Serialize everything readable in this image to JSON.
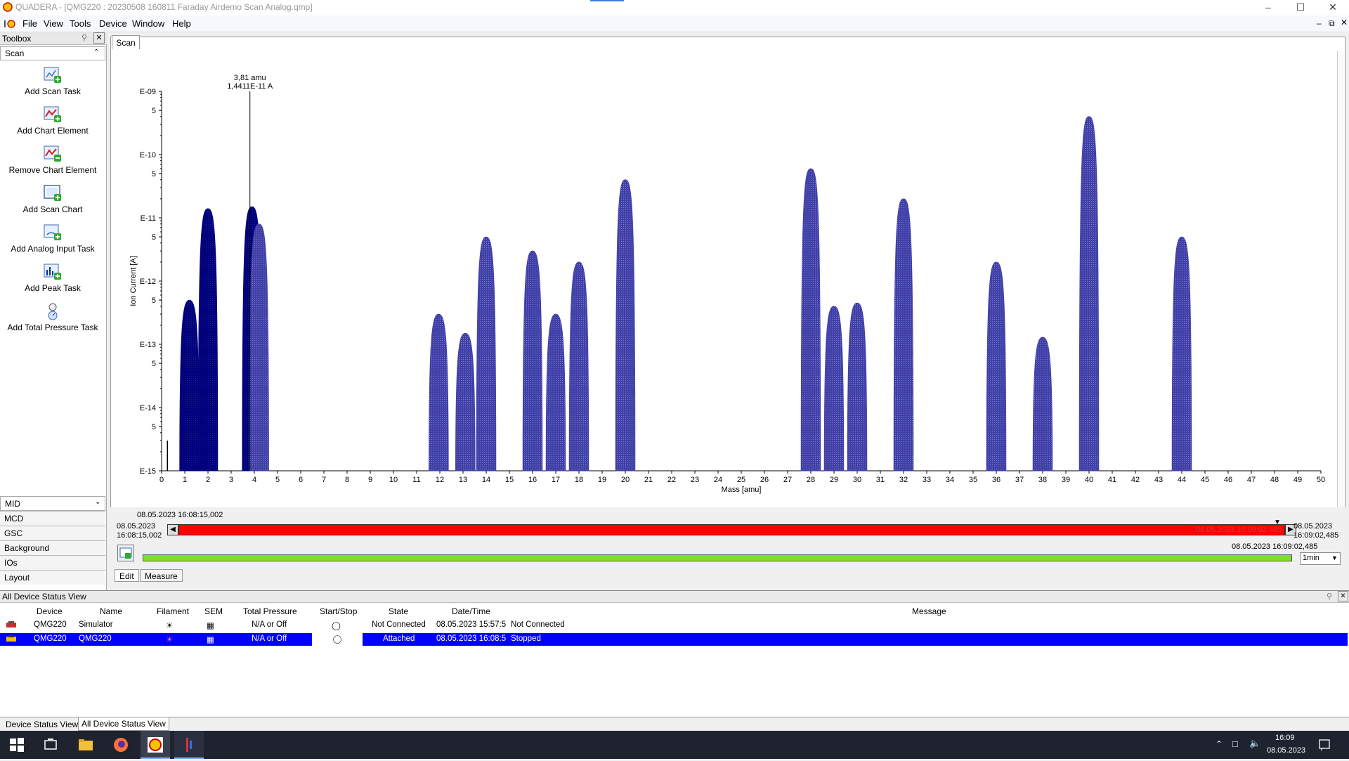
{
  "window": {
    "title": "QUADERA - [QMG220 : 20230508 160811 Faraday Airdemo Scan Analog.qmp]"
  },
  "menu": [
    "File",
    "View",
    "Tools",
    "Device",
    "Window",
    "Help"
  ],
  "toolbox": {
    "header": "Toolbox",
    "section": "Scan",
    "tools": [
      {
        "label": "Add Scan Task",
        "icon": "add-scan-task-icon"
      },
      {
        "label": "Add Chart Element",
        "icon": "add-chart-element-icon"
      },
      {
        "label": "Remove Chart Element",
        "icon": "remove-chart-element-icon"
      },
      {
        "label": "Add Scan Chart",
        "icon": "add-scan-chart-icon"
      },
      {
        "label": "Add Analog Input Task",
        "icon": "add-analog-input-icon"
      },
      {
        "label": "Add Peak Task",
        "icon": "add-peak-task-icon"
      },
      {
        "label": "Add Total Pressure Task",
        "icon": "add-total-pressure-icon"
      }
    ],
    "categories": [
      "MID",
      "MCD",
      "GSC",
      "Background",
      "IOs",
      "Layout"
    ]
  },
  "chart_tab": "Scan",
  "chart_data": {
    "type": "area",
    "xlabel": "Mass [amu]",
    "ylabel": "Ion Current [A]",
    "xlim": [
      0,
      50
    ],
    "yscale": "log",
    "ylim": [
      1e-15,
      1e-09
    ],
    "ytick_labels": [
      "E-09",
      "5",
      "E-10",
      "5",
      "E-11",
      "5",
      "E-12",
      "5",
      "E-13",
      "5",
      "E-14",
      "5",
      "E-15"
    ],
    "xtick_labels": [
      "0",
      "1",
      "2",
      "3",
      "4",
      "5",
      "6",
      "7",
      "8",
      "9",
      "10",
      "11",
      "12",
      "13",
      "14",
      "15",
      "16",
      "17",
      "18",
      "19",
      "20",
      "21",
      "22",
      "23",
      "24",
      "25",
      "26",
      "27",
      "28",
      "29",
      "30",
      "31",
      "32",
      "33",
      "34",
      "35",
      "36",
      "37",
      "38",
      "39",
      "40",
      "41",
      "42",
      "43",
      "44",
      "45",
      "46",
      "47",
      "48",
      "49",
      "50"
    ],
    "cursor": {
      "mass": "3,81 amu",
      "value": "1,4411E-11 A",
      "x": 3.81
    },
    "peaks": [
      {
        "mass": 1.2,
        "value": 5e-13,
        "color": "dark"
      },
      {
        "mass": 2.0,
        "value": 1.4e-11,
        "color": "dark"
      },
      {
        "mass": 3.9,
        "value": 1.5e-11,
        "color": "dark"
      },
      {
        "mass": 4.2,
        "value": 8e-12,
        "color": "blue"
      },
      {
        "mass": 11.95,
        "value": 3e-13,
        "color": "blue"
      },
      {
        "mass": 13.1,
        "value": 1.5e-13,
        "color": "blue"
      },
      {
        "mass": 14.0,
        "value": 5e-12,
        "color": "blue"
      },
      {
        "mass": 16.0,
        "value": 3e-12,
        "color": "blue"
      },
      {
        "mass": 17.0,
        "value": 3e-13,
        "color": "blue"
      },
      {
        "mass": 18.0,
        "value": 2e-12,
        "color": "blue"
      },
      {
        "mass": 20.0,
        "value": 4e-11,
        "color": "blue"
      },
      {
        "mass": 28.0,
        "value": 6e-11,
        "color": "blue"
      },
      {
        "mass": 29.0,
        "value": 4e-13,
        "color": "blue"
      },
      {
        "mass": 30.0,
        "value": 4.5e-13,
        "color": "blue"
      },
      {
        "mass": 32.0,
        "value": 2e-11,
        "color": "blue"
      },
      {
        "mass": 36.0,
        "value": 2e-12,
        "color": "blue"
      },
      {
        "mass": 38.0,
        "value": 1.3e-13,
        "color": "blue"
      },
      {
        "mass": 40.0,
        "value": 4e-10,
        "color": "blue"
      },
      {
        "mass": 44.0,
        "value": 5e-12,
        "color": "blue"
      }
    ],
    "colors": {
      "dark": "#00007a",
      "blue": "#4040a8"
    }
  },
  "timeline": {
    "start_label": "08.05.2023 16:08:15,002",
    "left_date": "08.05.2023",
    "left_time": "16:08:15,002",
    "right_date": "08.05.2023",
    "right_time": "16:09:02,485",
    "bar_text": "08.05.2023 16:09:02,485",
    "green_label": "08.05.2023 16:09:02,485",
    "interval": "1min"
  },
  "bottom_tabs": [
    "Edit",
    "Measure"
  ],
  "status_view": {
    "title": "All Device Status View",
    "columns": [
      "Device",
      "Name",
      "Filament",
      "SEM",
      "Total Pressure",
      "Start/Stop",
      "State",
      "Date/Time",
      "Message"
    ],
    "rows": [
      {
        "device": "QMG220",
        "name": "Simulator",
        "total_pressure": "N/A or Off",
        "state": "Not Connected",
        "datetime": "08.05.2023 15:57:5",
        "message": "Not Connected"
      },
      {
        "device": "QMG220",
        "name": "QMG220",
        "total_pressure": "N/A or Off",
        "state": "Attached",
        "datetime": "08.05.2023 16:08:5",
        "message": "Stopped"
      }
    ],
    "tabs": [
      "Device Status View",
      "All Device Status View"
    ]
  },
  "taskbar": {
    "time": "16:09",
    "date": "08.05.2023"
  }
}
